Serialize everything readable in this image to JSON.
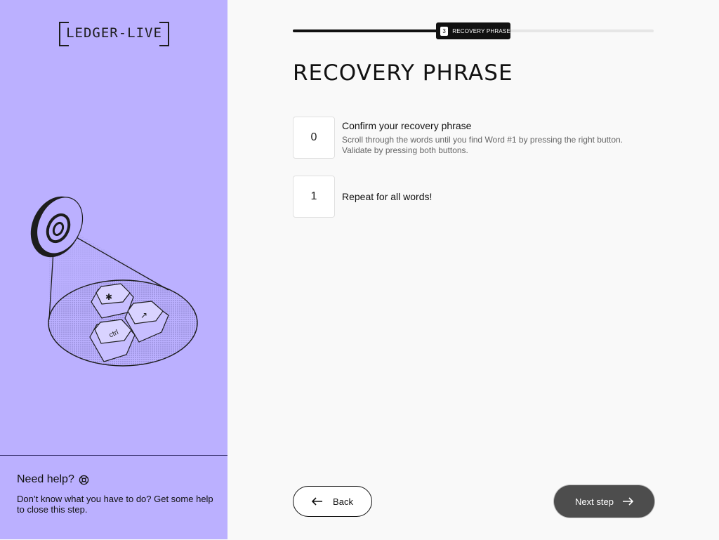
{
  "app": {
    "logo_text": "LEDGER-LIVE"
  },
  "progress": {
    "step_number": "3",
    "step_label": "RECOVERY PHRASE",
    "fraction": 0.42
  },
  "page": {
    "title": "RECOVERY PHRASE"
  },
  "steps": [
    {
      "index": "0",
      "title": "Confirm your recovery phrase",
      "description": "Scroll through the words until you find Word #1 by pressing the right button. Validate by pressing both buttons."
    },
    {
      "index": "1",
      "title": "Repeat for all words!",
      "description": ""
    }
  ],
  "help": {
    "title": "Need help?",
    "text": "Don’t know what you have to do? Get some help to close this step."
  },
  "footer": {
    "back_label": "Back",
    "next_label": "Next step"
  },
  "illustration": {
    "key_labels": [
      "✱",
      "↗",
      "ctrl"
    ]
  },
  "colors": {
    "sidebar": "#bbb0ff",
    "accent": "#111111",
    "next_button": "#4d4d4d"
  }
}
